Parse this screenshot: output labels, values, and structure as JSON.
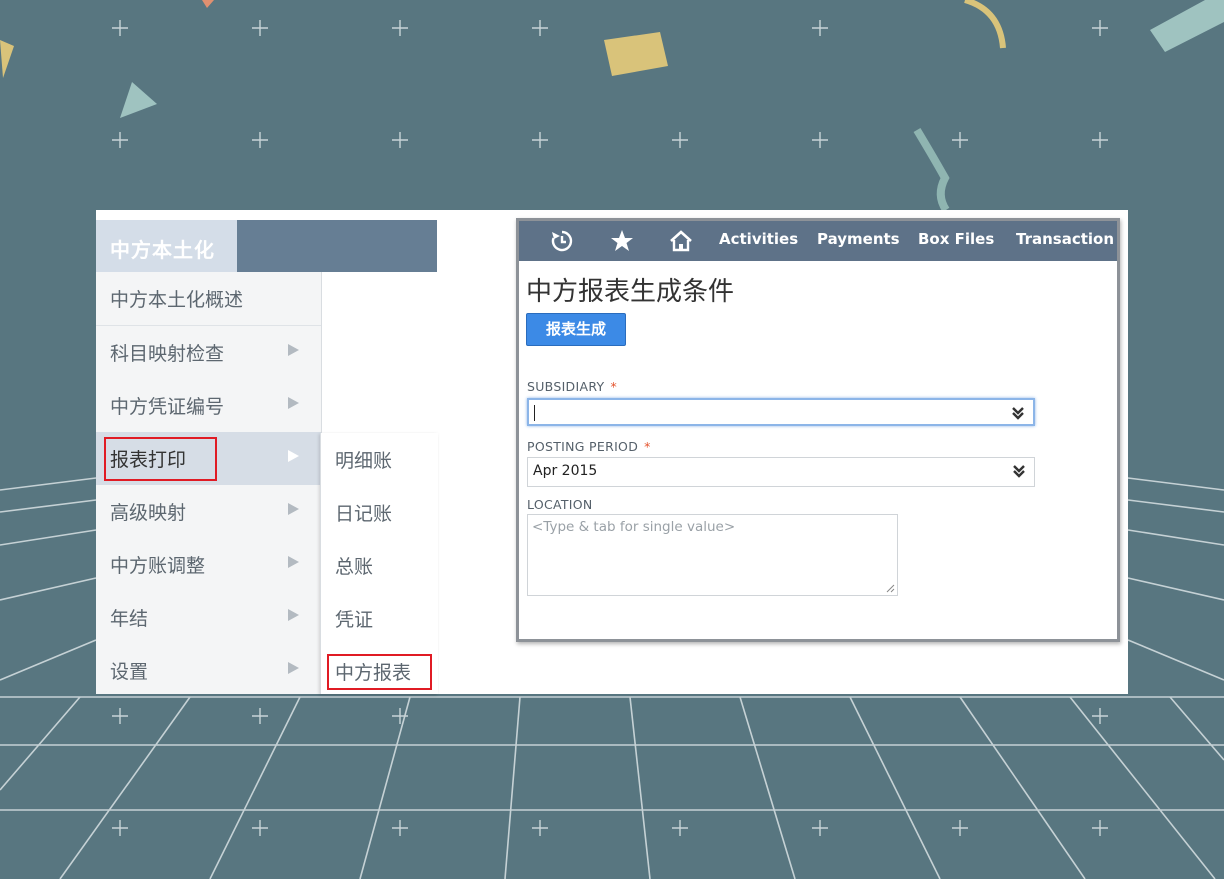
{
  "menu": {
    "title": "中方本土化",
    "items": [
      {
        "label": "中方本土化概述",
        "has_arrow": false
      },
      {
        "label": "科目映射检查",
        "has_arrow": true
      },
      {
        "label": "中方凭证编号",
        "has_arrow": true
      },
      {
        "label": "报表打印",
        "has_arrow": true,
        "active": true
      },
      {
        "label": "高级映射",
        "has_arrow": true
      },
      {
        "label": "中方账调整",
        "has_arrow": true
      },
      {
        "label": "年结",
        "has_arrow": true
      },
      {
        "label": "设置",
        "has_arrow": true
      }
    ],
    "submenu": [
      "明细账",
      "日记账",
      "总账",
      "凭证",
      "中方报表"
    ]
  },
  "nav": {
    "icons": [
      "recent-icon",
      "star-icon",
      "home-icon"
    ],
    "links": [
      "Activities",
      "Payments",
      "Box Files",
      "Transaction"
    ]
  },
  "form": {
    "title": "中方报表生成条件",
    "button": "报表生成",
    "subsidiary": {
      "label": "SUBSIDIARY",
      "required_mark": "*",
      "value": ""
    },
    "posting_period": {
      "label": "POSTING PERIOD",
      "required_mark": "*",
      "value": "Apr 2015"
    },
    "location": {
      "label": "LOCATION",
      "placeholder": "<Type & tab for single value>"
    }
  },
  "colors": {
    "background": "#587680",
    "nav_bar": "#5e7288",
    "menu_header": "#667e94",
    "button": "#3c8ae6",
    "highlight_box": "#e01b24"
  }
}
